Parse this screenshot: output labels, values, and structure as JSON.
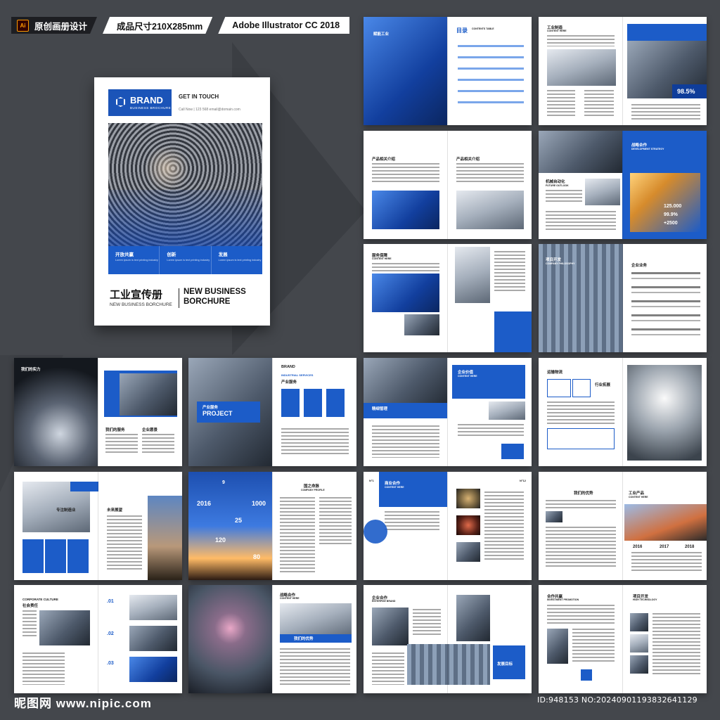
{
  "header": {
    "app_badge": "Ai",
    "label_1": "原创画册设计",
    "label_2": "成品尺寸210X285mm",
    "label_3": "Adobe Illustrator CC 2018"
  },
  "cover": {
    "brand": "BRAND",
    "brand_sub": "BUSINESS BROCHURE",
    "get_in_touch": "GET IN TOUCH",
    "contact": "Call Now | 123 568     email@domain.com",
    "pillars": [
      {
        "title": "开放共赢",
        "desc": "Lorem ipsum is text printing industry"
      },
      {
        "title": "创新",
        "desc": "Lorem ipsum is text printing industry"
      },
      {
        "title": "发展",
        "desc": "Lorem ipsum is text printing industry"
      }
    ],
    "title_zh": "工业宣传册",
    "title_en_small": "NEW BUSINESS BORCHURE",
    "title_en_big_1": "NEW BUSINESS",
    "title_en_big_2": "BORCHURE"
  },
  "spreads": {
    "s1": {
      "zh": "赋能工业",
      "toc": "目录",
      "toc_en": "CONTENTS TABLE"
    },
    "s2": {
      "zh": "工业制造",
      "en": "CONTENT HERE",
      "stat": "98.5%"
    },
    "s3": {
      "a": "产品相关介绍",
      "b": "产品相关介绍"
    },
    "s4": {
      "zh": "战略合作",
      "en": "DEVELOPMENT STRATEGY",
      "left_zh": "机械自动化",
      "left_en": "FUTURE OUTLOOK",
      "s1": "125.000",
      "s2": "99.9%",
      "s3": "+2500"
    },
    "s5": {
      "zh": "服务保障",
      "en": "CONTENT HERE"
    },
    "s6": {
      "zh": "项目开发",
      "en": "COMPANY PHILOSOPHY",
      "right": "企业业务"
    },
    "s7": {
      "zh": "我们的实力",
      "a": "我们的服务",
      "b": "企业愿景"
    },
    "s8": {
      "zh": "产业服务",
      "en": "PROJECT",
      "brand": "BRAND",
      "right_en": "INDUSTRIAL SERVICES",
      "right_zh": "产业服务"
    },
    "s9": {
      "zh": "精细管理",
      "en": "CONTENT HERE",
      "right_zh": "企业价值",
      "right_en": "CONTENT HERE"
    },
    "s10": {
      "zh": "运输物流",
      "tag": "行业拓展"
    },
    "s11": {
      "zh": "专注制造业",
      "en": "CONTENT HERE",
      "b": "未来展望"
    },
    "s12": {
      "y1": "2016",
      "y2": "1000",
      "y3": "120",
      "y4": "25",
      "y5": "80",
      "y6": "9",
      "right": "国之命脉",
      "right_en": "COMPANY PROFILE"
    },
    "s13": {
      "no": "N°1",
      "no2": "N°12",
      "zh": "商业合作",
      "en": "CONTENT HERE"
    },
    "s14": {
      "zh": "我们的优势",
      "right_zh": "工业产品",
      "right_en": "CONTENT HERE",
      "y1": "2016",
      "y2": "2017",
      "y3": "2018"
    },
    "s15": {
      "en": "CORPORATE CULTURE",
      "zh": "社会责任",
      "n1": ".01",
      "n2": ".02",
      "n3": ".03"
    },
    "s16": {
      "zh": "战略合作",
      "en": "CONTENT HERE",
      "tag": "我们的优势"
    },
    "s17": {
      "zh": "企业合作",
      "en": "ENTERPISE BRAND",
      "tag": "发展目标"
    },
    "s18": {
      "zh": "合作共赢",
      "en": "INVESTMENT PROMOTION",
      "right_zh": "项目开发",
      "right_en": "HIGH TECHNOLOGY"
    }
  },
  "footer": {
    "watermark": "昵图网 www.nipic.com",
    "id": "ID:948153 NO:20240901193832641129"
  }
}
